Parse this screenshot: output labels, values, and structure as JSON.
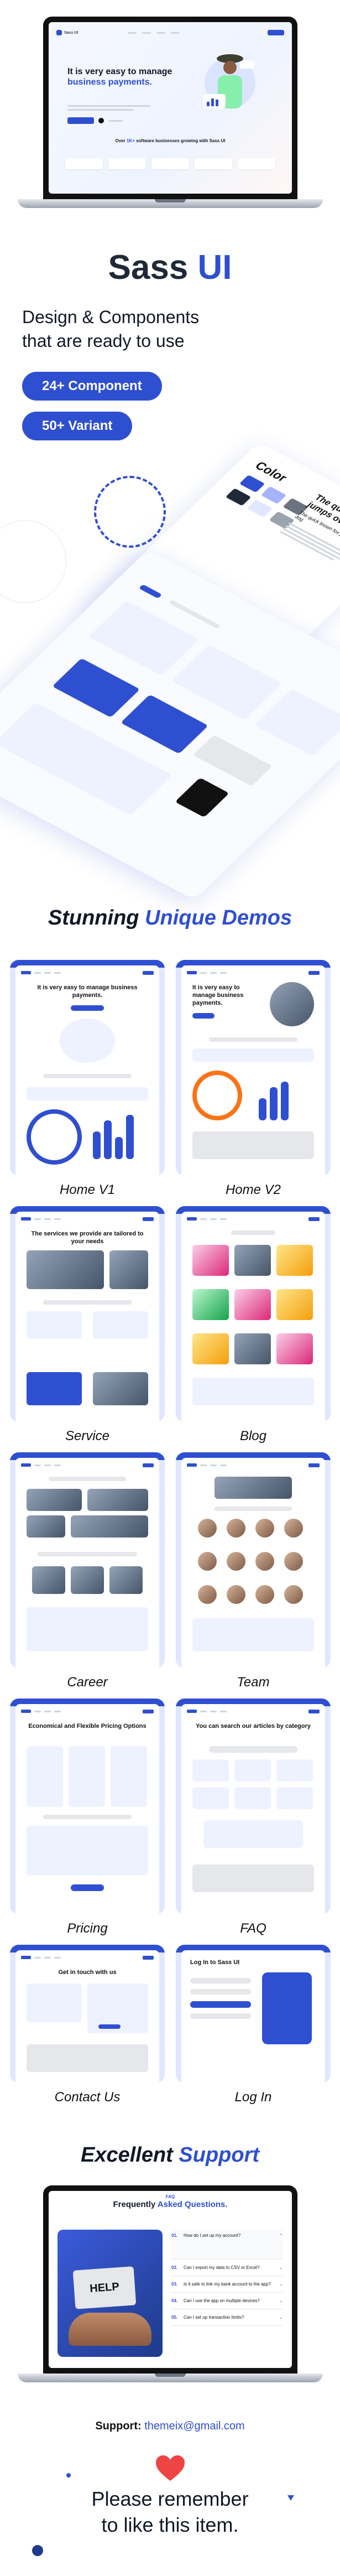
{
  "hero_site": {
    "logo_text": "Sass UI",
    "headline_part1": "It is very easy to manage ",
    "headline_highlight": "business payments.",
    "stats_prefix": "Over ",
    "stats_highlight": "1K+",
    "stats_suffix": " software businesses growing with Sass UI"
  },
  "brand": {
    "name_part1": "Sass ",
    "name_part2": "UI"
  },
  "tagline": {
    "line1": "Design & Components",
    "line2": "that are ready to use"
  },
  "badges": {
    "components": "24+ Component",
    "variants": "50+ Variant"
  },
  "showcase": {
    "color_label": "Color",
    "typography_line1": "The quick brown fox jumps over",
    "typography_line2": "The quick brown fox jumps over the lazy dog"
  },
  "demos_heading": {
    "part1": "Stunning ",
    "part2": "Unique Demos"
  },
  "demos": [
    {
      "label": "Home V1",
      "title": "It is very easy to manage business payments."
    },
    {
      "label": "Home V2",
      "title": "It is very easy to manage business payments."
    },
    {
      "label": "Service",
      "title": "The services we provide are tailored to your needs"
    },
    {
      "label": "Blog",
      "title": ""
    },
    {
      "label": "Career",
      "title": ""
    },
    {
      "label": "Team",
      "title": ""
    },
    {
      "label": "Pricing",
      "title": "Economical and Flexible Pricing Options"
    },
    {
      "label": "FAQ",
      "title": "You can search our articles by category"
    },
    {
      "label": "Contact Us",
      "title": "Get in touch with us"
    },
    {
      "label": "Log In",
      "title": "Log In to Sass UI"
    }
  ],
  "support_heading": {
    "part1": "Excellent ",
    "part2": "Support"
  },
  "faq_site": {
    "kicker": "FAQ",
    "heading_part1": "Frequently ",
    "heading_part2": "Asked Questions.",
    "help_card": "HELP",
    "items": [
      {
        "num": "01.",
        "question": "How do I set up my account?"
      },
      {
        "num": "02.",
        "question": "Can I export my data to CSV or Excel?"
      },
      {
        "num": "03.",
        "question": "Is it safe to link my bank account to the app?"
      },
      {
        "num": "04.",
        "question": "Can I use the app on multiple devices?"
      },
      {
        "num": "05.",
        "question": "Can I set up transaction limits?"
      }
    ]
  },
  "support": {
    "label": "Support:",
    "email": "themeix@gmail.com"
  },
  "closing": {
    "line1": "Please remember",
    "line2": "to like this item."
  },
  "colors": {
    "accent": "#2f4fd1",
    "dark": "#1f2937"
  }
}
